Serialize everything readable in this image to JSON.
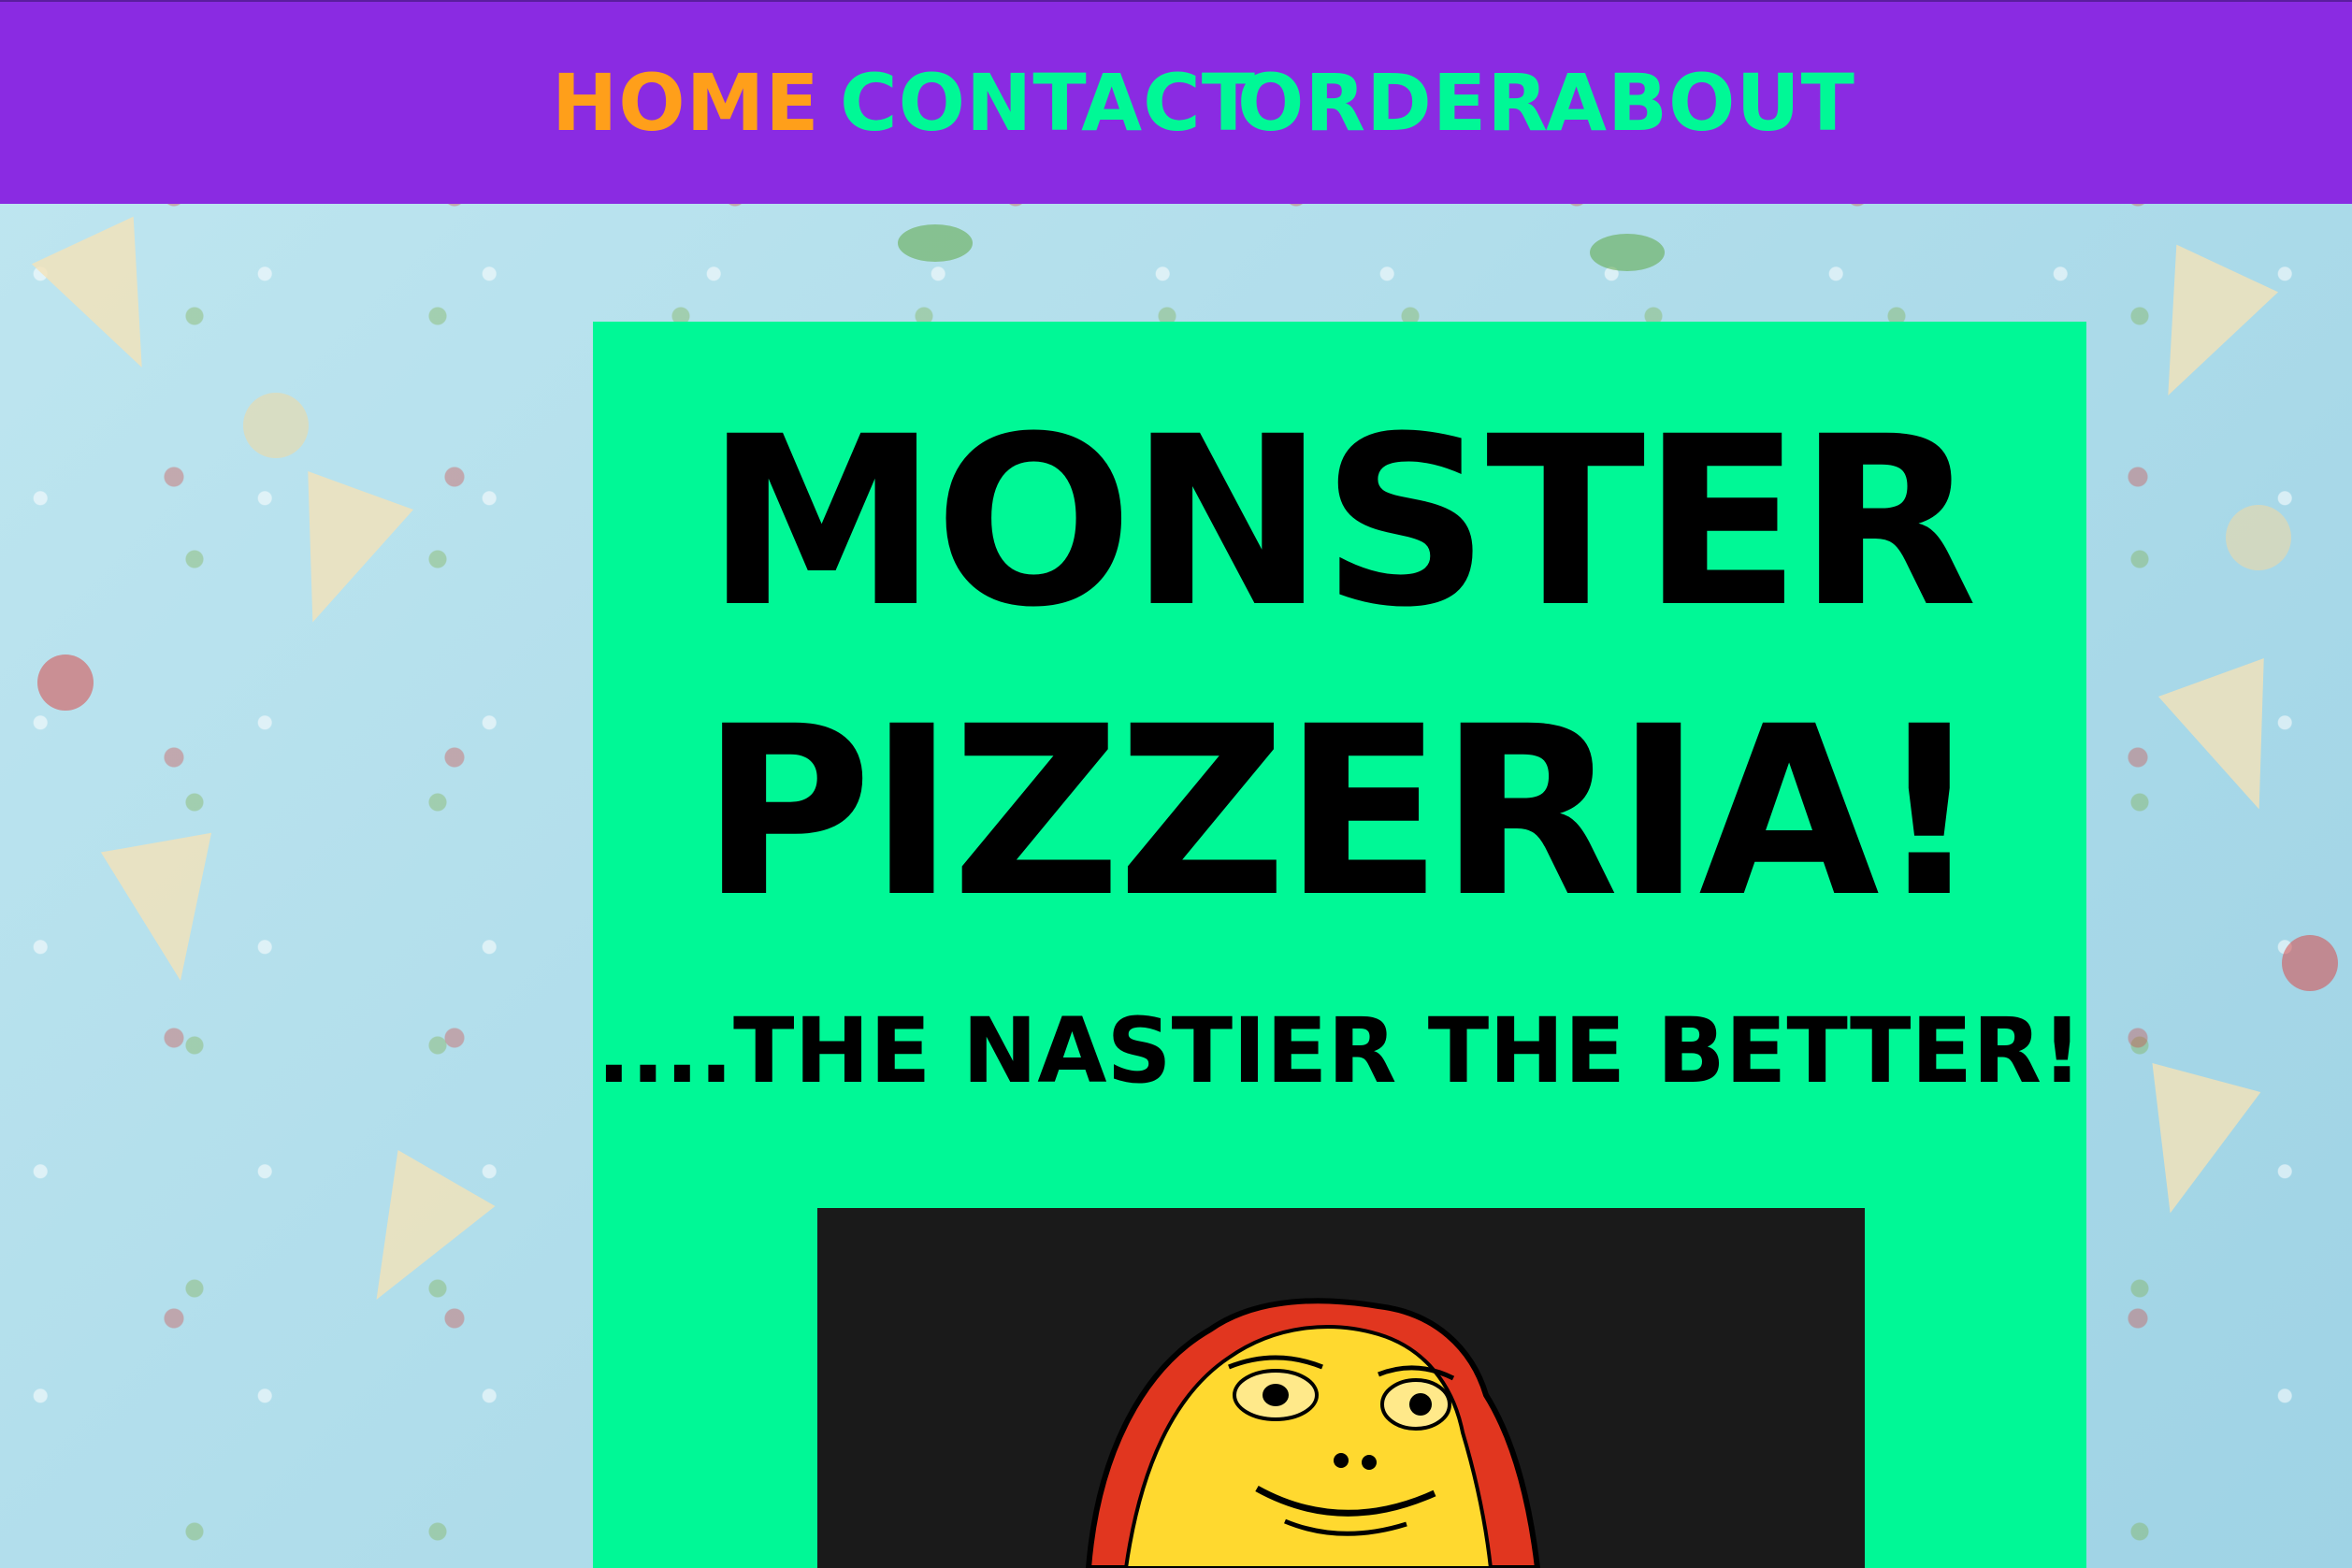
{
  "nav": {
    "items": [
      {
        "label": "HOME",
        "active": true
      },
      {
        "label": "CONTACT",
        "active": false
      },
      {
        "label": "ORDER",
        "active": false
      },
      {
        "label": "ABOUT",
        "active": false
      }
    ]
  },
  "hero": {
    "title_line1": "MONSTER",
    "title_line2": "PIZZERIA!",
    "tagline": "....THE NASTIER THE BETTER!"
  },
  "colors": {
    "nav_bg": "#8a2be2",
    "nav_active": "#ff9f1a",
    "nav_link": "#00f896",
    "panel_bg": "#00f896",
    "page_bg": "#a9dbe9",
    "image_bg": "#1a1a1a"
  },
  "icons": {
    "background": "pizza-pattern-background",
    "hero_image": "pizza-monster-illustration"
  }
}
